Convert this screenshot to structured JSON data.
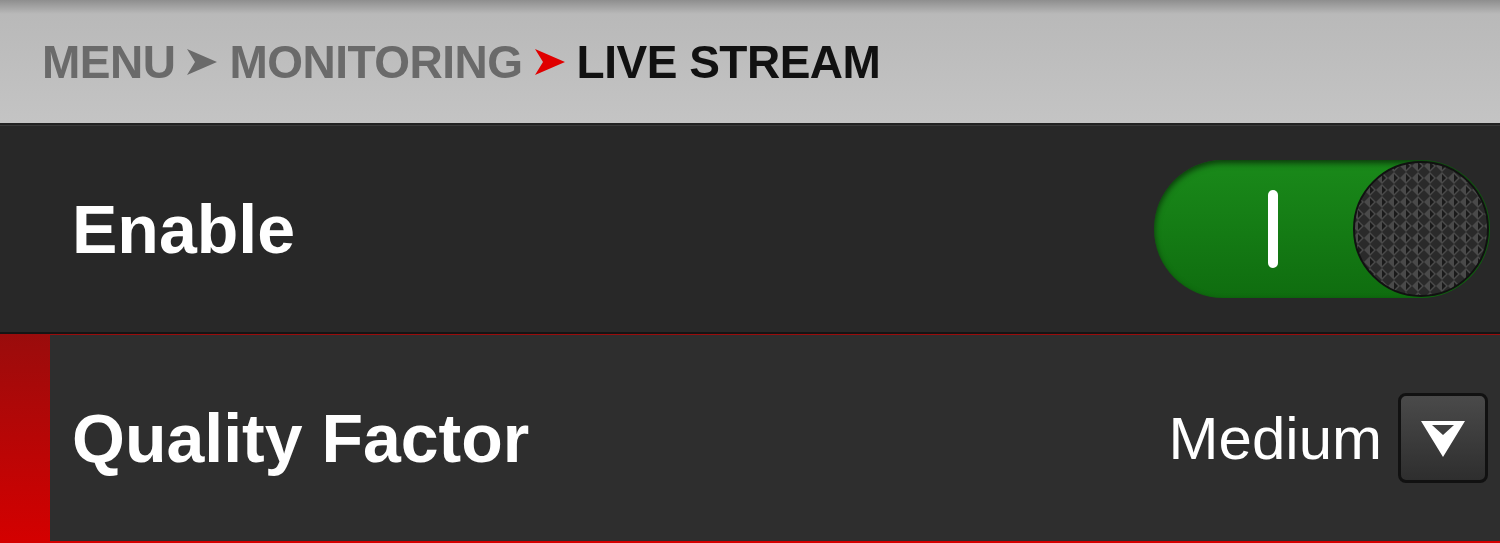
{
  "breadcrumb": [
    {
      "label": "MENU",
      "current": false
    },
    {
      "label": "MONITORING",
      "current": false
    },
    {
      "label": "LIVE STREAM",
      "current": true
    }
  ],
  "rows": [
    {
      "kind": "toggle",
      "label": "Enable",
      "on": true,
      "selected": false
    },
    {
      "kind": "dropdown",
      "label": "Quality Factor",
      "value": "Medium",
      "selected": true
    }
  ]
}
